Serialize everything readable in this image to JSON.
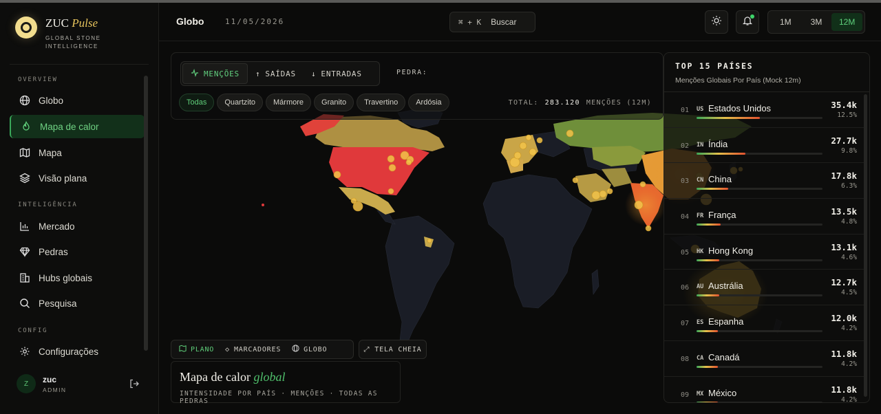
{
  "brand": {
    "name": "ZUC",
    "name_accent": "Pulse",
    "tagline_1": "GLOBAL STONE",
    "tagline_2": "INTELLIGENCE"
  },
  "sidebar": {
    "sections": {
      "overview": "OVERVIEW",
      "intel": "INTELIGÊNCIA",
      "config": "CONFIG"
    },
    "items": [
      {
        "label": "Globo",
        "icon": "globe-icon"
      },
      {
        "label": "Mapa de calor",
        "icon": "flame-icon",
        "active": true
      },
      {
        "label": "Mapa",
        "icon": "map-icon"
      },
      {
        "label": "Visão plana",
        "icon": "layers-icon"
      },
      {
        "label": "Mercado",
        "icon": "bar-chart-icon"
      },
      {
        "label": "Pedras",
        "icon": "diamond-icon"
      },
      {
        "label": "Hubs globais",
        "icon": "building-icon"
      },
      {
        "label": "Pesquisa",
        "icon": "search-icon"
      },
      {
        "label": "Configurações",
        "icon": "gear-icon"
      }
    ],
    "user": {
      "initial": "Z",
      "name": "zuc",
      "role": "ADMIN"
    }
  },
  "header": {
    "title": "Globo",
    "date": "11/05/2026",
    "search_kbd": "⌘ + K",
    "search_label": "Buscar",
    "ranges": [
      "1M",
      "3M",
      "12M"
    ],
    "active_range": "12M"
  },
  "controls": {
    "metrics": [
      "MENÇÕES",
      "SAÍDAS",
      "ENTRADAS"
    ],
    "active_metric": "MENÇÕES",
    "pedra_label": "PEDRA:",
    "stones": [
      "Todas",
      "Quartzito",
      "Mármore",
      "Granito",
      "Travertino",
      "Ardósia"
    ],
    "active_stone": "Todas",
    "total_label": "TOTAL:",
    "total_value": "283.120",
    "total_unit": "MENÇÕES (12M)"
  },
  "view": {
    "modes": [
      "PLANO",
      "MARCADORES",
      "GLOBO"
    ],
    "active_mode": "PLANO",
    "fullscreen": "TELA CHEIA"
  },
  "caption": {
    "title": "Mapa de calor",
    "title_accent": "global",
    "subtitle": "INTENSIDADE POR PAÍS · MENÇÕES · TODAS AS PEDRAS"
  },
  "ranking": {
    "title": "TOP 15 PAÍSES",
    "subtitle": "Menções Globais Por País (Mock 12m)",
    "rows": [
      {
        "rank": "01",
        "code": "US",
        "name": "Estados Unidos",
        "value": "35.4k",
        "pct": "12.5%",
        "share": 0.5
      },
      {
        "rank": "02",
        "code": "IN",
        "name": "Índia",
        "value": "27.7k",
        "pct": "9.8%",
        "share": 0.39
      },
      {
        "rank": "03",
        "code": "CN",
        "name": "China",
        "value": "17.8k",
        "pct": "6.3%",
        "share": 0.25
      },
      {
        "rank": "04",
        "code": "FR",
        "name": "França",
        "value": "13.5k",
        "pct": "4.8%",
        "share": 0.19
      },
      {
        "rank": "05",
        "code": "HK",
        "name": "Hong Kong",
        "value": "13.1k",
        "pct": "4.6%",
        "share": 0.18
      },
      {
        "rank": "06",
        "code": "AU",
        "name": "Austrália",
        "value": "12.7k",
        "pct": "4.5%",
        "share": 0.18
      },
      {
        "rank": "07",
        "code": "ES",
        "name": "Espanha",
        "value": "12.0k",
        "pct": "4.2%",
        "share": 0.17
      },
      {
        "rank": "08",
        "code": "CA",
        "name": "Canadá",
        "value": "11.8k",
        "pct": "4.2%",
        "share": 0.17
      },
      {
        "rank": "09",
        "code": "MX",
        "name": "México",
        "value": "11.8k",
        "pct": "4.2%",
        "share": 0.17
      }
    ]
  },
  "colors": {
    "accent_green": "#5fcf7a",
    "heat_high": "#e2413a",
    "heat_mid": "#e6a13a",
    "heat_low": "#c8b050",
    "marker": "#f2c34a"
  }
}
